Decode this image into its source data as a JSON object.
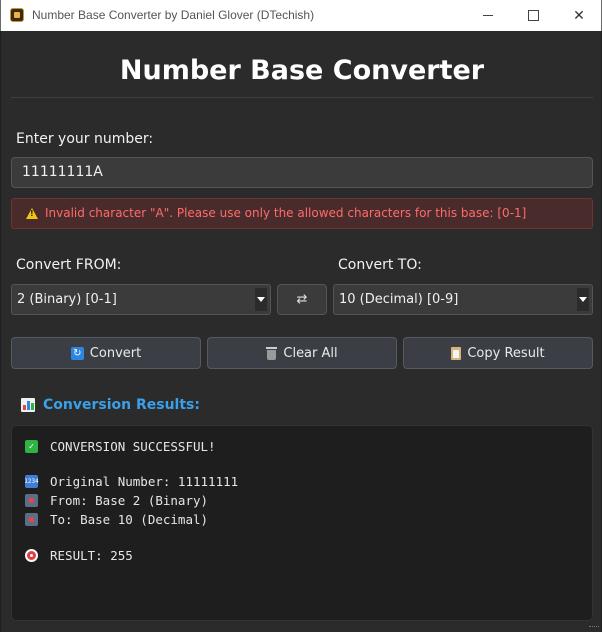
{
  "window": {
    "title": "Number Base Converter by Daniel Glover (DTechish)"
  },
  "header": {
    "title": "Number Base Converter"
  },
  "input": {
    "label": "Enter your number:",
    "value": "11111111A"
  },
  "error": {
    "message": "Invalid character \"A\". Please use only the allowed characters for this base: [0-1]",
    "color": "#ff6b6b"
  },
  "convert_from": {
    "label": "Convert FROM:",
    "selected": "2 (Binary) [0-1]"
  },
  "convert_to": {
    "label": "Convert TO:",
    "selected": "10 (Decimal) [0-9]"
  },
  "swap": {
    "label": "⇄"
  },
  "actions": {
    "convert": "Convert",
    "clear": "Clear All",
    "copy": "Copy Result"
  },
  "results": {
    "title": "Conversion Results:",
    "accent": "#3aa0e8",
    "status": "CONVERSION SUCCESSFUL!",
    "original": "Original Number: 11111111",
    "from": "From: Base 2 (Binary)",
    "to": "To: Base 10 (Decimal)",
    "result": "RESULT: 255"
  },
  "icons": {
    "app": "app-icon",
    "warning": "warning-icon",
    "convert": "convert-icon",
    "clear": "trash-icon",
    "copy": "clipboard-icon",
    "results": "bar-chart-icon",
    "status": "check-icon",
    "original": "numbers-icon",
    "from": "inbox-icon",
    "to": "outbox-icon",
    "result": "target-icon"
  }
}
